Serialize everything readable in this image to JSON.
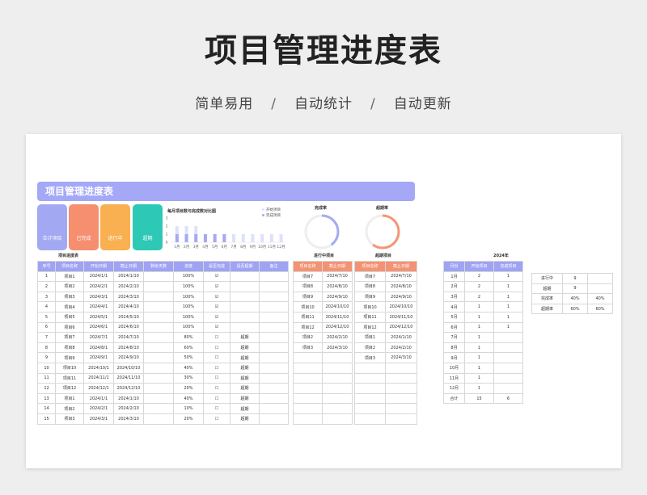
{
  "page": {
    "title": "项目管理进度表",
    "subtitle": [
      "简单易用",
      "自动统计",
      "自动更新"
    ],
    "separator": "/"
  },
  "sheet": {
    "header": "项目管理进度表",
    "cards": [
      {
        "label": "合计项目",
        "color": "#a3a8f3"
      },
      {
        "label": "已完成",
        "color": "#f58f6f"
      },
      {
        "label": "进行中",
        "color": "#f8b050"
      },
      {
        "label": "超期",
        "color": "#2ec8b6"
      }
    ],
    "chart_data": {
      "type": "bar",
      "title": "每月项目数与完成数对比图",
      "categories": [
        "1月",
        "2月",
        "3月",
        "4月",
        "5月",
        "6月",
        "7月",
        "8月",
        "9月",
        "10月",
        "11月",
        "12月"
      ],
      "ylim": [
        0,
        3
      ],
      "yticks": [
        "3",
        "2",
        "1",
        "0"
      ],
      "series": [
        {
          "name": "开始项目",
          "values": [
            2,
            2,
            2,
            1,
            1,
            1,
            1,
            1,
            1,
            1,
            1,
            1
          ],
          "color": "#dfe1fb"
        },
        {
          "name": "完成项目",
          "values": [
            1,
            1,
            1,
            1,
            1,
            1,
            0,
            0,
            0,
            0,
            0,
            0
          ],
          "color": "#a5a9f3"
        }
      ]
    },
    "gauge_done": {
      "title": "完成率",
      "value": 0.4,
      "color": "#a5a9f3"
    },
    "gauge_over": {
      "title": "超期率",
      "value": 0.6,
      "color": "#f59574"
    },
    "main_table": {
      "caption": "项目进度表",
      "headers": [
        "序号",
        "项目名称",
        "开始日期",
        "截止日期",
        "剩余天数",
        "进度",
        "是否完成",
        "是否超期",
        "备注"
      ],
      "rows": [
        [
          "1",
          "项目1",
          "2024/1/1",
          "2024/1/10",
          "",
          "100%",
          "☑",
          "",
          ""
        ],
        [
          "2",
          "项目2",
          "2024/2/1",
          "2024/2/10",
          "",
          "100%",
          "☑",
          "",
          ""
        ],
        [
          "3",
          "项目3",
          "2024/3/1",
          "2024/3/10",
          "",
          "100%",
          "☑",
          "",
          ""
        ],
        [
          "4",
          "项目4",
          "2024/4/1",
          "2024/4/10",
          "",
          "100%",
          "☑",
          "",
          ""
        ],
        [
          "5",
          "项目5",
          "2024/5/1",
          "2024/5/10",
          "",
          "100%",
          "☑",
          "",
          ""
        ],
        [
          "6",
          "项目6",
          "2024/6/1",
          "2024/6/10",
          "",
          "100%",
          "☑",
          "",
          ""
        ],
        [
          "7",
          "项目7",
          "2024/7/1",
          "2024/7/10",
          "",
          "80%",
          "☐",
          "超期",
          ""
        ],
        [
          "8",
          "项目8",
          "2024/8/1",
          "2024/8/10",
          "",
          "60%",
          "☐",
          "超期",
          ""
        ],
        [
          "9",
          "项目9",
          "2024/9/1",
          "2024/9/10",
          "",
          "50%",
          "☐",
          "超期",
          ""
        ],
        [
          "10",
          "项目10",
          "2024/10/1",
          "2024/10/10",
          "",
          "40%",
          "☐",
          "超期",
          ""
        ],
        [
          "11",
          "项目11",
          "2024/11/1",
          "2024/11/10",
          "",
          "30%",
          "☐",
          "超期",
          ""
        ],
        [
          "12",
          "项目12",
          "2024/12/1",
          "2024/12/10",
          "",
          "20%",
          "☐",
          "超期",
          ""
        ],
        [
          "13",
          "项目1",
          "2024/1/1",
          "2024/1/10",
          "",
          "40%",
          "☐",
          "超期",
          ""
        ],
        [
          "14",
          "项目2",
          "2024/2/1",
          "2024/2/10",
          "",
          "10%",
          "☐",
          "超期",
          ""
        ],
        [
          "15",
          "项目3",
          "2024/3/1",
          "2024/3/10",
          "",
          "20%",
          "☐",
          "超期",
          ""
        ]
      ]
    },
    "progress_table": {
      "caption": "进行中项目",
      "headers": [
        "项目名称",
        "截止日期"
      ],
      "rows": [
        [
          "项目7",
          "2024/7/10"
        ],
        [
          "项目8",
          "2024/8/10"
        ],
        [
          "项目9",
          "2024/9/10"
        ],
        [
          "项目10",
          "2024/10/10"
        ],
        [
          "项目11",
          "2024/11/10"
        ],
        [
          "项目12",
          "2024/12/10"
        ],
        [
          "项目2",
          "2024/2/10"
        ],
        [
          "项目3",
          "2024/3/10"
        ],
        [
          "",
          ""
        ],
        [
          "",
          ""
        ],
        [
          "",
          ""
        ],
        [
          "",
          ""
        ],
        [
          "",
          ""
        ],
        [
          "",
          ""
        ],
        [
          "",
          ""
        ]
      ]
    },
    "over_table": {
      "caption": "超期项目",
      "headers": [
        "项目名称",
        "截止日期"
      ],
      "rows": [
        [
          "项目7",
          "2024/7/10"
        ],
        [
          "项目8",
          "2024/8/10"
        ],
        [
          "项目9",
          "2024/9/10"
        ],
        [
          "项目10",
          "2024/10/10"
        ],
        [
          "项目11",
          "2024/11/10"
        ],
        [
          "项目12",
          "2024/12/10"
        ],
        [
          "项目1",
          "2024/1/10"
        ],
        [
          "项目2",
          "2024/2/10"
        ],
        [
          "项目3",
          "2024/3/10"
        ],
        [
          "",
          ""
        ],
        [
          "",
          ""
        ],
        [
          "",
          ""
        ],
        [
          "",
          ""
        ],
        [
          "",
          ""
        ],
        [
          "",
          ""
        ]
      ]
    },
    "year_table": {
      "caption": "2024年",
      "headers": [
        "月份",
        "开始项目",
        "完成项目"
      ],
      "rows": [
        [
          "1月",
          "2",
          "1"
        ],
        [
          "2月",
          "2",
          "1"
        ],
        [
          "3月",
          "2",
          "1"
        ],
        [
          "4月",
          "1",
          "1"
        ],
        [
          "5月",
          "1",
          "1"
        ],
        [
          "6月",
          "1",
          "1"
        ],
        [
          "7月",
          "1",
          ""
        ],
        [
          "8月",
          "1",
          ""
        ],
        [
          "9月",
          "1",
          ""
        ],
        [
          "10月",
          "1",
          ""
        ],
        [
          "11月",
          "1",
          ""
        ],
        [
          "12月",
          "1",
          ""
        ],
        [
          "合计",
          "15",
          "6"
        ]
      ]
    },
    "stats_table": {
      "rows": [
        [
          "进行中",
          "9",
          ""
        ],
        [
          "超期",
          "9",
          ""
        ],
        [
          "完成率",
          "40%",
          "40%"
        ],
        [
          "超期率",
          "60%",
          "60%"
        ]
      ]
    }
  }
}
